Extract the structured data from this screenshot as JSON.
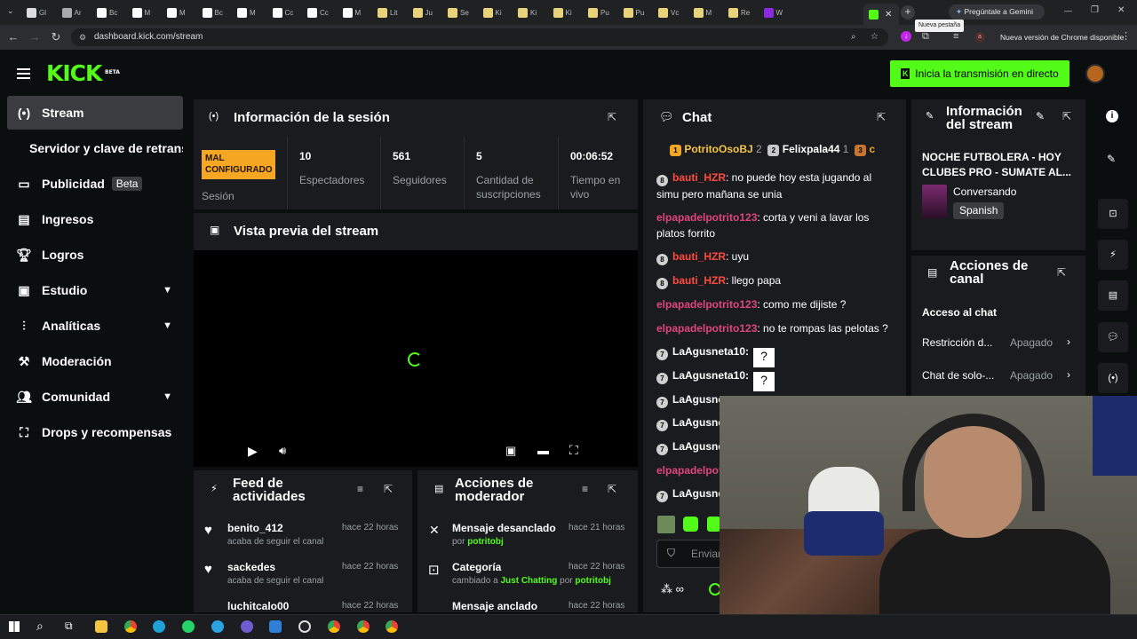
{
  "browser": {
    "url": "dashboard.kick.com/stream",
    "tooltip": "Nueva pestaña",
    "gemini": "Pregúntale a Gemini",
    "update": "Nueva versión de Chrome disponible",
    "tabs": [
      "Gl",
      "Ar",
      "Bc",
      "M",
      "M",
      "Bc",
      "M",
      "Cc",
      "Cc",
      "M",
      "Lit",
      "Ju",
      "Se",
      "Ki",
      "Ki",
      "Ki",
      "Pu",
      "Pu",
      "Vc",
      "M",
      "Re",
      "W"
    ]
  },
  "header": {
    "logo": "KICK",
    "logo_tag": "BETA",
    "go_live": "Inicia la transmisión en directo"
  },
  "sidebar": {
    "items": [
      {
        "label": "Stream"
      },
      {
        "label": "Servidor y clave de retransm"
      },
      {
        "label": "Publicidad",
        "badge": "Beta"
      },
      {
        "label": "Ingresos"
      },
      {
        "label": "Logros"
      },
      {
        "label": "Estudio"
      },
      {
        "label": "Analíticas"
      },
      {
        "label": "Moderación"
      },
      {
        "label": "Comunidad"
      },
      {
        "label": "Drops y recompensas"
      }
    ]
  },
  "session": {
    "title": "Información de la sesión",
    "status": "MAL CONFIGURADO",
    "status_label": "Sesión",
    "stats": [
      {
        "value": "10",
        "label": "Espectadores"
      },
      {
        "value": "561",
        "label": "Seguidores"
      },
      {
        "value": "5",
        "label": "Cantidad de suscripciones"
      },
      {
        "value": "00:06:52",
        "label": "Tiempo en vivo"
      }
    ]
  },
  "preview": {
    "title": "Vista previa del stream"
  },
  "feed": {
    "title": "Feed de actividades",
    "items": [
      {
        "user": "benito_412",
        "sub": "acaba de seguir el canal",
        "time": "hace 22 horas"
      },
      {
        "user": "sackedes",
        "sub": "acaba de seguir el canal",
        "time": "hace 22 horas"
      },
      {
        "user": "luchitcalo00",
        "sub": "",
        "time": "hace 22 horas"
      }
    ]
  },
  "modactions": {
    "title": "Acciones de moderador",
    "items": [
      {
        "action": "Mensaje desanclado",
        "sub_pre": "por",
        "sub_user": "potritobj",
        "time": "hace 21 horas"
      },
      {
        "action": "Categoría",
        "sub_pre": "cambiado a",
        "sub_cat": "Just Chatting",
        "sub_mid": "por",
        "sub_user": "potritobj",
        "time": "hace 22 horas"
      },
      {
        "action": "Mensaje anclado",
        "time": "hace 22 horas"
      }
    ]
  },
  "chat": {
    "title": "Chat",
    "top": [
      {
        "rank": "1",
        "name": "PotritoOsoBJ",
        "count": "2"
      },
      {
        "rank": "2",
        "name": "Felixpala44",
        "count": "1"
      },
      {
        "rank": "3",
        "name": "c"
      }
    ],
    "messages": [
      {
        "badge": "8",
        "user": "bauti_HZR",
        "text": ": no puede hoy esta jugando al simu pero mañana se unia"
      },
      {
        "user": "elpapadelpotrito123",
        "text": ": corta y veni a lavar los platos forrito"
      },
      {
        "badge": "8",
        "user": "bauti_HZR",
        "text": ": uyu"
      },
      {
        "badge": "8",
        "user": "bauti_HZR",
        "text": ": llego papa"
      },
      {
        "user": "elpapadelpotrito123",
        "text": ": como me dijiste ?"
      },
      {
        "user": "elpapadelpotrito123",
        "text": ": no te rompas las pelotas ?"
      },
      {
        "badge": "7",
        "user": "LaAgusneta10",
        "text": ":"
      },
      {
        "badge": "7",
        "user": "LaAgusneta10",
        "text": ":"
      },
      {
        "badge": "7",
        "user": "LaAgusne"
      },
      {
        "badge": "7",
        "user": "LaAgusne"
      },
      {
        "badge": "7",
        "user": "LaAgusne"
      },
      {
        "user": "elpapadelpot"
      },
      {
        "badge": "7",
        "user": "LaAgusne"
      }
    ],
    "input_placeholder": "Enviar"
  },
  "stream_info": {
    "title": "Información del stream",
    "stream_title": "NOCHE FUTBOLERA - HOY CLUBES PRO - SUMATE AL...",
    "category": "Conversando",
    "language": "Spanish"
  },
  "channel_actions": {
    "title": "Acciones de canal",
    "section": "Acceso al chat",
    "rows": [
      {
        "label": "Restricción d...",
        "value": "Apagado"
      },
      {
        "label": "Chat de solo-...",
        "value": "Apagado"
      }
    ]
  },
  "colors": {
    "accent": "#53fc18",
    "warning": "#f5a623",
    "panel": "#191b1f",
    "bg": "#0b0e0f"
  }
}
